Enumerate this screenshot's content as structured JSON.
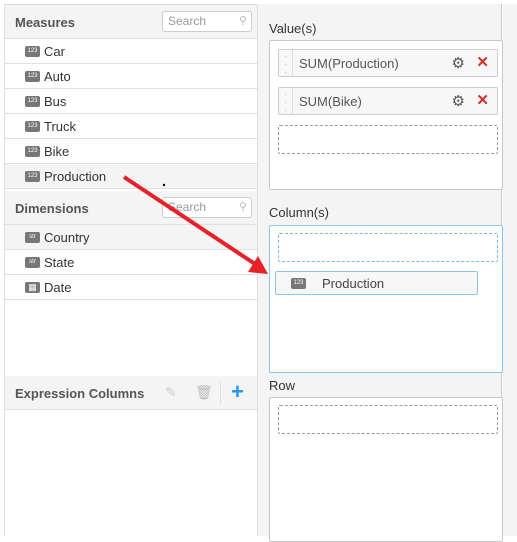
{
  "measures": {
    "title": "Measures",
    "search_placeholder": "Search",
    "items": [
      {
        "label": "Car",
        "type": "123"
      },
      {
        "label": "Auto",
        "type": "123"
      },
      {
        "label": "Bus",
        "type": "123"
      },
      {
        "label": "Truck",
        "type": "123"
      },
      {
        "label": "Bike",
        "type": "123"
      },
      {
        "label": "Production",
        "type": "123"
      }
    ]
  },
  "dimensions": {
    "title": "Dimensions",
    "search_placeholder": "Search",
    "items": [
      {
        "label": "Country",
        "type": "str"
      },
      {
        "label": "State",
        "type": "str"
      },
      {
        "label": "Date",
        "type": "date"
      }
    ]
  },
  "expression_columns": {
    "title": "Expression Columns",
    "icons": [
      "edit-icon",
      "delete-icon",
      "add-icon"
    ]
  },
  "values": {
    "title": "Value(s)",
    "items": [
      {
        "label": "SUM(Production)"
      },
      {
        "label": "SUM(Bike)"
      }
    ]
  },
  "columns": {
    "title": "Column(s)",
    "dragging_item": {
      "label": "Production",
      "type": "123"
    }
  },
  "row": {
    "title": "Row"
  },
  "colors": {
    "accent": "#2196f3",
    "remove": "#d32f2f",
    "arrow": "#e8202a",
    "drop_highlight": "#8cc4f0"
  }
}
